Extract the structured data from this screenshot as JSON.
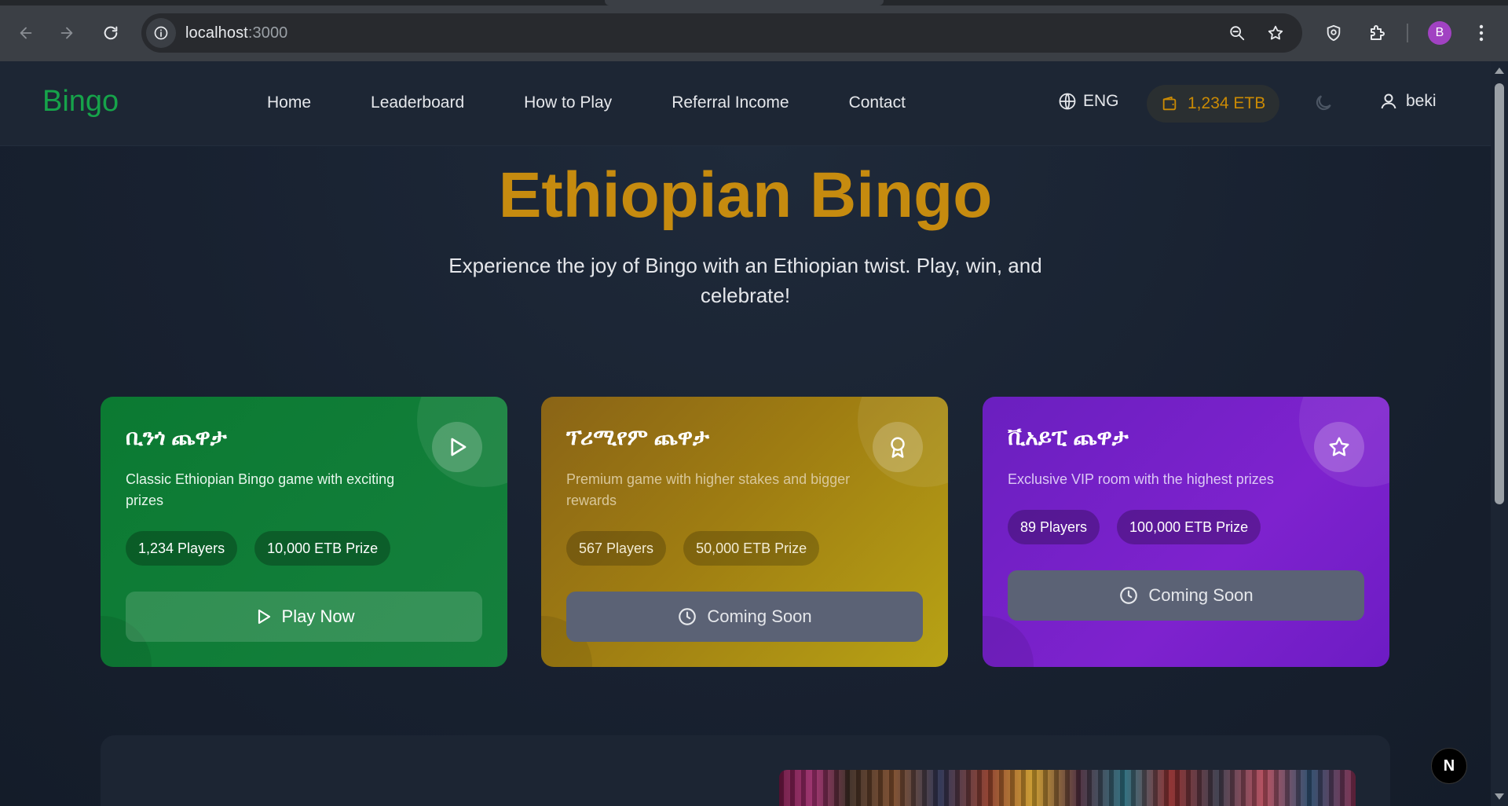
{
  "browser": {
    "url_host": "localhost",
    "url_port": ":3000",
    "profile_initial": "B"
  },
  "site": {
    "logo": "Bingo",
    "nav": [
      "Home",
      "Leaderboard",
      "How to Play",
      "Referral Income",
      "Contact"
    ],
    "language": "ENG",
    "wallet_balance": "1,234 ETB",
    "username": "beki"
  },
  "hero": {
    "title": "Ethiopian Bingo",
    "subtitle": "Experience the joy of Bingo with an Ethiopian twist. Play, win, and celebrate!"
  },
  "games": [
    {
      "title": "ቢንጎ ጨዋታ",
      "description": "Classic Ethiopian Bingo game with exciting prizes",
      "players": "1,234 Players",
      "prize": "10,000 ETB Prize",
      "action": "Play Now",
      "icon": "play-icon"
    },
    {
      "title": "ፕሪሚየም ጨዋታ",
      "description": "Premium game with higher stakes and bigger rewards",
      "players": "567 Players",
      "prize": "50,000 ETB Prize",
      "action": "Coming Soon",
      "icon": "award-icon"
    },
    {
      "title": "ቪአይፒ ጨዋታ",
      "description": "Exclusive VIP room with the highest prizes",
      "players": "89 Players",
      "prize": "100,000 ETB Prize",
      "action": "Coming Soon",
      "icon": "star-icon"
    }
  ],
  "dev_badge": "N",
  "colors": {
    "brand_green": "#16a34a",
    "accent_gold": "#ca8a04",
    "card_green": "#15803d",
    "card_gold": "#a16207",
    "card_purple": "#7e22ce"
  }
}
